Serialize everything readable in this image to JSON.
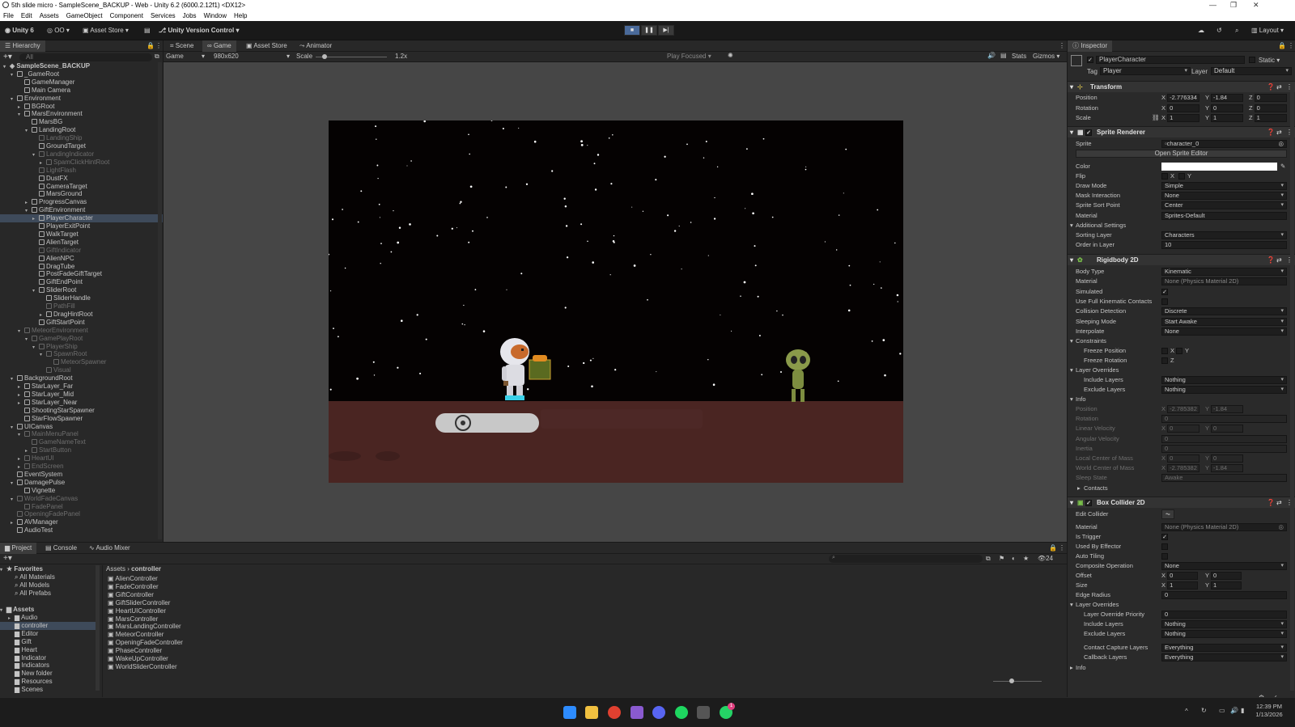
{
  "window": {
    "title": "5th slide micro - SampleScene_BACKUP - Web - Unity 6.2 (6000.2.12f1) <DX12>"
  },
  "menu": [
    "File",
    "Edit",
    "Assets",
    "GameObject",
    "Component",
    "Services",
    "Jobs",
    "Window",
    "Help"
  ],
  "toolbar": {
    "account": "Unity 6",
    "cloud_label": "OO",
    "asset_store": "Asset Store",
    "vcs": "Unity Version Control",
    "layout": "Layout"
  },
  "hierarchy": {
    "tab": "Hierarchy",
    "search_placeholder": "All",
    "rows": [
      {
        "label": "SampleScene_BACKUP",
        "depth": 0,
        "dim": false,
        "sel": false,
        "exp": "▾"
      },
      {
        "label": "_GameRoot",
        "depth": 1,
        "dim": false,
        "sel": false,
        "exp": "▾"
      },
      {
        "label": "GameManager",
        "depth": 2,
        "dim": false,
        "sel": false,
        "exp": ""
      },
      {
        "label": "Main Camera",
        "depth": 2,
        "dim": false,
        "sel": false,
        "exp": ""
      },
      {
        "label": "Environment",
        "depth": 1,
        "dim": false,
        "sel": false,
        "exp": "▾"
      },
      {
        "label": "BGRoot",
        "depth": 2,
        "dim": false,
        "sel": false,
        "exp": "▸"
      },
      {
        "label": "MarsEnvironment",
        "depth": 2,
        "dim": false,
        "sel": false,
        "exp": "▾"
      },
      {
        "label": "MarsBG",
        "depth": 3,
        "dim": false,
        "sel": false,
        "exp": ""
      },
      {
        "label": "LandingRoot",
        "depth": 3,
        "dim": false,
        "sel": false,
        "exp": "▾"
      },
      {
        "label": "LandingShip",
        "depth": 4,
        "dim": true,
        "sel": false,
        "exp": ""
      },
      {
        "label": "GroundTarget",
        "depth": 4,
        "dim": false,
        "sel": false,
        "exp": ""
      },
      {
        "label": "LandingIndicator",
        "depth": 4,
        "dim": true,
        "sel": false,
        "exp": "▾"
      },
      {
        "label": "SpamClickHintRoot",
        "depth": 5,
        "dim": true,
        "sel": false,
        "exp": "▸"
      },
      {
        "label": "LightFlash",
        "depth": 4,
        "dim": true,
        "sel": false,
        "exp": ""
      },
      {
        "label": "DustFX",
        "depth": 4,
        "dim": false,
        "sel": false,
        "exp": ""
      },
      {
        "label": "CameraTarget",
        "depth": 4,
        "dim": false,
        "sel": false,
        "exp": ""
      },
      {
        "label": "MarsGround",
        "depth": 4,
        "dim": false,
        "sel": false,
        "exp": ""
      },
      {
        "label": "ProgressCanvas",
        "depth": 3,
        "dim": false,
        "sel": false,
        "exp": "▸"
      },
      {
        "label": "GiftEnvironment",
        "depth": 3,
        "dim": false,
        "sel": false,
        "exp": "▾"
      },
      {
        "label": "PlayerCharacter",
        "depth": 4,
        "dim": false,
        "sel": true,
        "exp": "▸"
      },
      {
        "label": "PlayerExitPoint",
        "depth": 4,
        "dim": false,
        "sel": false,
        "exp": ""
      },
      {
        "label": "WalkTarget",
        "depth": 4,
        "dim": false,
        "sel": false,
        "exp": ""
      },
      {
        "label": "AlienTarget",
        "depth": 4,
        "dim": false,
        "sel": false,
        "exp": ""
      },
      {
        "label": "GiftIndicator",
        "depth": 4,
        "dim": true,
        "sel": false,
        "exp": ""
      },
      {
        "label": "AlienNPC",
        "depth": 4,
        "dim": false,
        "sel": false,
        "exp": ""
      },
      {
        "label": "DragTube",
        "depth": 4,
        "dim": false,
        "sel": false,
        "exp": ""
      },
      {
        "label": "PostFadeGiftTarget",
        "depth": 4,
        "dim": false,
        "sel": false,
        "exp": ""
      },
      {
        "label": "GiftEndPoint",
        "depth": 4,
        "dim": false,
        "sel": false,
        "exp": ""
      },
      {
        "label": "SliderRoot",
        "depth": 4,
        "dim": false,
        "sel": false,
        "exp": "▾"
      },
      {
        "label": "SliderHandle",
        "depth": 5,
        "dim": false,
        "sel": false,
        "exp": ""
      },
      {
        "label": "PathFill",
        "depth": 5,
        "dim": true,
        "sel": false,
        "exp": ""
      },
      {
        "label": "DragHintRoot",
        "depth": 5,
        "dim": false,
        "sel": false,
        "exp": "▸"
      },
      {
        "label": "GiftStartPoint",
        "depth": 4,
        "dim": false,
        "sel": false,
        "exp": ""
      },
      {
        "label": "MeteorEnvironment",
        "depth": 2,
        "dim": true,
        "sel": false,
        "exp": "▾"
      },
      {
        "label": "GamePlayRoot",
        "depth": 3,
        "dim": true,
        "sel": false,
        "exp": "▾"
      },
      {
        "label": "PlayerShip",
        "depth": 4,
        "dim": true,
        "sel": false,
        "exp": "▾"
      },
      {
        "label": "SpawnRoot",
        "depth": 5,
        "dim": true,
        "sel": false,
        "exp": "▾"
      },
      {
        "label": "MeteorSpawner",
        "depth": 6,
        "dim": true,
        "sel": false,
        "exp": ""
      },
      {
        "label": "Visual",
        "depth": 5,
        "dim": true,
        "sel": false,
        "exp": ""
      },
      {
        "label": "BackgroundRoot",
        "depth": 1,
        "dim": false,
        "sel": false,
        "exp": "▾"
      },
      {
        "label": "StarLayer_Far",
        "depth": 2,
        "dim": false,
        "sel": false,
        "exp": "▸"
      },
      {
        "label": "StarLayer_Mid",
        "depth": 2,
        "dim": false,
        "sel": false,
        "exp": "▸"
      },
      {
        "label": "StarLayer_Near",
        "depth": 2,
        "dim": false,
        "sel": false,
        "exp": "▸"
      },
      {
        "label": "ShootingStarSpawner",
        "depth": 2,
        "dim": false,
        "sel": false,
        "exp": ""
      },
      {
        "label": "StarFlowSpawner",
        "depth": 2,
        "dim": false,
        "sel": false,
        "exp": ""
      },
      {
        "label": "UICanvas",
        "depth": 1,
        "dim": false,
        "sel": false,
        "exp": "▾"
      },
      {
        "label": "MainMenuPanel",
        "depth": 2,
        "dim": true,
        "sel": false,
        "exp": "▾"
      },
      {
        "label": "GameNameText",
        "depth": 3,
        "dim": true,
        "sel": false,
        "exp": ""
      },
      {
        "label": "StartButton",
        "depth": 3,
        "dim": true,
        "sel": false,
        "exp": "▸"
      },
      {
        "label": "HeartUI",
        "depth": 2,
        "dim": true,
        "sel": false,
        "exp": "▸"
      },
      {
        "label": "EndScreen",
        "depth": 2,
        "dim": true,
        "sel": false,
        "exp": "▸"
      },
      {
        "label": "EventSystem",
        "depth": 1,
        "dim": false,
        "sel": false,
        "exp": ""
      },
      {
        "label": "DamagePulse",
        "depth": 1,
        "dim": false,
        "sel": false,
        "exp": "▾"
      },
      {
        "label": "Vignette",
        "depth": 2,
        "dim": false,
        "sel": false,
        "exp": ""
      },
      {
        "label": "WorldFadeCanvas",
        "depth": 1,
        "dim": true,
        "sel": false,
        "exp": "▾"
      },
      {
        "label": "FadePanel",
        "depth": 2,
        "dim": true,
        "sel": false,
        "exp": ""
      },
      {
        "label": "OpeningFadePanel",
        "depth": 1,
        "dim": true,
        "sel": false,
        "exp": ""
      },
      {
        "label": "AVManager",
        "depth": 1,
        "dim": false,
        "sel": false,
        "exp": "▸"
      },
      {
        "label": "AudioTest",
        "depth": 1,
        "dim": false,
        "sel": false,
        "exp": ""
      }
    ]
  },
  "center": {
    "tabs": [
      "Scene",
      "Game",
      "Asset Store",
      "Animator"
    ],
    "display": "Game",
    "resolution": "980x620",
    "scale_label": "Scale",
    "scale_value": "1.2x",
    "play_focused": "Play Focused",
    "stats": "Stats",
    "gizmos": "Gizmos"
  },
  "inspector": {
    "tab": "Inspector",
    "object_name": "PlayerCharacter",
    "static_label": "Static",
    "tag_label": "Tag",
    "tag": "Player",
    "layer_label": "Layer",
    "layer": "Default",
    "transform": {
      "title": "Transform",
      "rows": [
        {
          "label": "Position",
          "x": "-2.776334",
          "y": "-1.84",
          "z": "0"
        },
        {
          "label": "Rotation",
          "x": "0",
          "y": "0",
          "z": "0"
        },
        {
          "label": "Scale",
          "x": "1",
          "y": "1",
          "z": "1"
        }
      ]
    },
    "sprite_renderer": {
      "title": "Sprite Renderer",
      "sprite_label": "Sprite",
      "sprite": "character_0",
      "open_editor": "Open Sprite Editor",
      "color_label": "Color",
      "color": "#ffffff",
      "flip_label": "Flip",
      "flip_x": "X",
      "flip_y": "Y",
      "rows": [
        {
          "label": "Draw Mode",
          "value": "Simple"
        },
        {
          "label": "Mask Interaction",
          "value": "None"
        },
        {
          "label": "Sprite Sort Point",
          "value": "Center"
        },
        {
          "label": "Material",
          "value": "Sprites-Default"
        }
      ],
      "additional": "Additional Settings",
      "rows2": [
        {
          "label": "Sorting Layer",
          "value": "Characters"
        },
        {
          "label": "Order in Layer",
          "value": "10"
        }
      ]
    },
    "rigidbody": {
      "title": "Rigidbody 2D",
      "rows": [
        {
          "label": "Body Type",
          "value": "Kinematic",
          "kind": "dd"
        },
        {
          "label": "Material",
          "value": "None (Physics Material 2D)",
          "kind": "obj"
        },
        {
          "label": "Simulated",
          "value": "✓",
          "kind": "chk"
        },
        {
          "label": "Use Full Kinematic Contacts",
          "value": "",
          "kind": "chk"
        },
        {
          "label": "Collision Detection",
          "value": "Discrete",
          "kind": "dd"
        },
        {
          "label": "Sleeping Mode",
          "value": "Start Awake",
          "kind": "dd"
        },
        {
          "label": "Interpolate",
          "value": "None",
          "kind": "dd"
        }
      ],
      "constraints": "Constraints",
      "freeze_pos": "Freeze Position",
      "freeze_rot": "Freeze Rotation",
      "layer_overrides": "Layer Overrides",
      "include_layers": "Include Layers",
      "exclude_layers": "Exclude Layers",
      "nothing": "Nothing",
      "info": "Info",
      "info_rows": [
        {
          "label": "Position",
          "x": "-2.785382",
          "y": "-1.84"
        },
        {
          "label": "Rotation",
          "v": "0"
        },
        {
          "label": "Linear Velocity",
          "x": "0",
          "y": "0"
        },
        {
          "label": "Angular Velocity",
          "v": "0"
        },
        {
          "label": "Inertia",
          "v": "0"
        },
        {
          "label": "Local Center of Mass",
          "x": "0",
          "y": "0"
        },
        {
          "label": "World Center of Mass",
          "x": "-2.785382",
          "y": "-1.84"
        },
        {
          "label": "Sleep State",
          "v": "Awake"
        }
      ],
      "contacts": "Contacts"
    },
    "box_collider": {
      "title": "Box Collider 2D",
      "edit_collider": "Edit Collider",
      "material": "None (Physics Material 2D)",
      "is_trigger": "Is Trigger",
      "used_by_effector": "Used By Effector",
      "auto_tiling": "Auto Tiling",
      "composite": "Composite Operation",
      "composite_value": "None",
      "offset_label": "Offset",
      "offset_x": "0",
      "offset_y": "0",
      "size_label": "Size",
      "size_x": "1",
      "size_y": "1",
      "edge_radius": "Edge Radius",
      "edge_value": "0",
      "layer_overrides": "Layer Overrides",
      "priority": "Layer Override Priority",
      "priority_value": "0",
      "include_layers": "Include Layers",
      "exclude_layers": "Exclude Layers",
      "nothing": "Nothing",
      "contact_capture": "Contact Capture Layers",
      "callback": "Callback Layers",
      "everything": "Everything",
      "info": "Info"
    }
  },
  "project": {
    "tabs": [
      "Project",
      "Console",
      "Audio Mixer"
    ],
    "favorites": "Favorites",
    "fav_items": [
      "All Materials",
      "All Models",
      "All Prefabs"
    ],
    "assets": "Assets",
    "folders": [
      "Audio",
      "controller",
      "Editor",
      "Gift",
      "Heart",
      "Indicator",
      "Indicators",
      "New folder",
      "Resources",
      "Scenes"
    ],
    "breadcrumb_root": "Assets",
    "breadcrumb_leaf": "controller",
    "files": [
      "AlienController",
      "FadeController",
      "GiftController",
      "GiftSliderController",
      "HeartUIController",
      "MarsController",
      "MarsLandingController",
      "MeteorController",
      "OpeningFadeController",
      "PhaseController",
      "WakeUpController",
      "WorldSliderController"
    ],
    "count": "24"
  },
  "taskbar": {
    "time": "12:39 PM",
    "date": "1/13/2026",
    "notif": "1"
  }
}
